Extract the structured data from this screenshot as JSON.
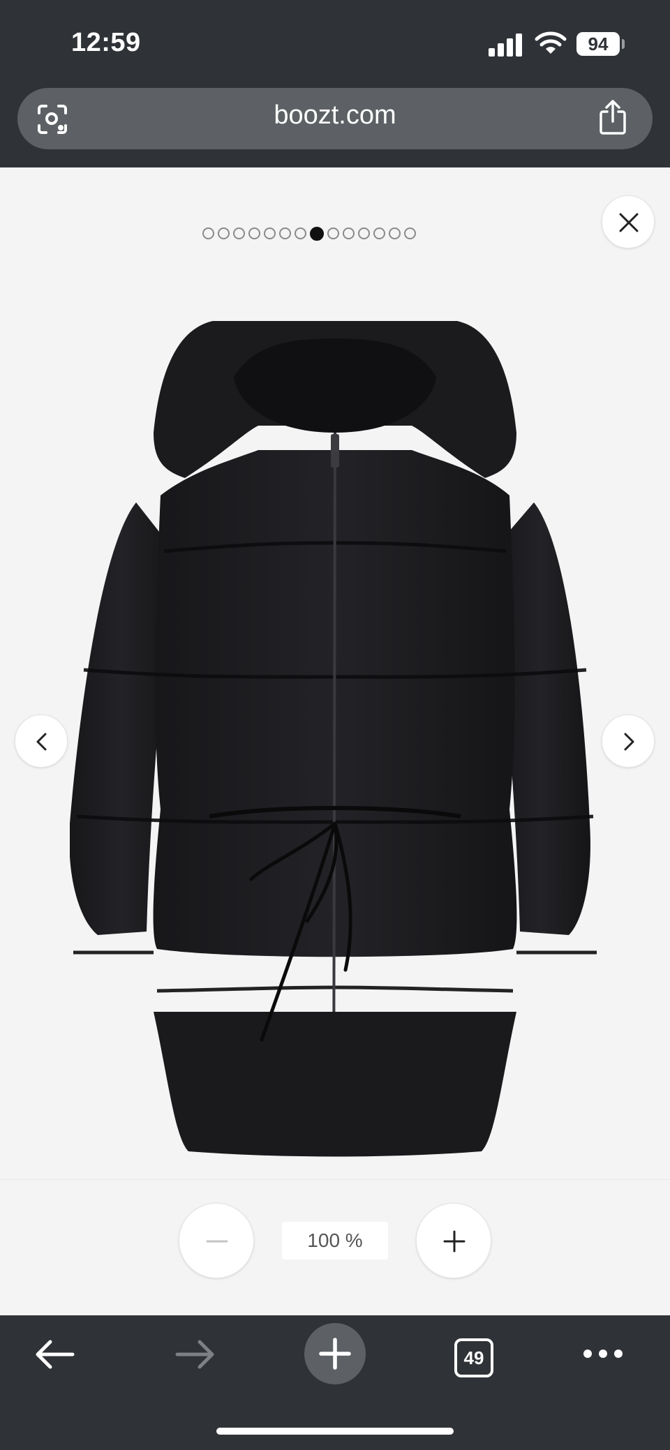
{
  "status_bar": {
    "time": "12:59",
    "battery": "94",
    "icons": [
      "cellular-signal-icon",
      "wifi-icon",
      "battery-icon"
    ]
  },
  "browser": {
    "url": "boozt.com",
    "tab_count": "49",
    "icons": [
      "lens-icon",
      "share-icon",
      "back-arrow-icon",
      "forward-arrow-icon",
      "plus-icon",
      "more-icon"
    ]
  },
  "gallery": {
    "image_count": 14,
    "active_index": 7,
    "image_subject": "black hooded puffer jacket with drawstring waist",
    "icons": [
      "close-icon",
      "chevron-left-icon",
      "chevron-right-icon"
    ]
  },
  "zoom": {
    "level": "100 %",
    "icons": [
      "minus-icon",
      "plus-icon"
    ]
  },
  "colors": {
    "chrome": "#2f3236",
    "url_bar": "#5d6165",
    "page_bg": "#f4f4f4",
    "jacket": "#1c1c1e"
  }
}
